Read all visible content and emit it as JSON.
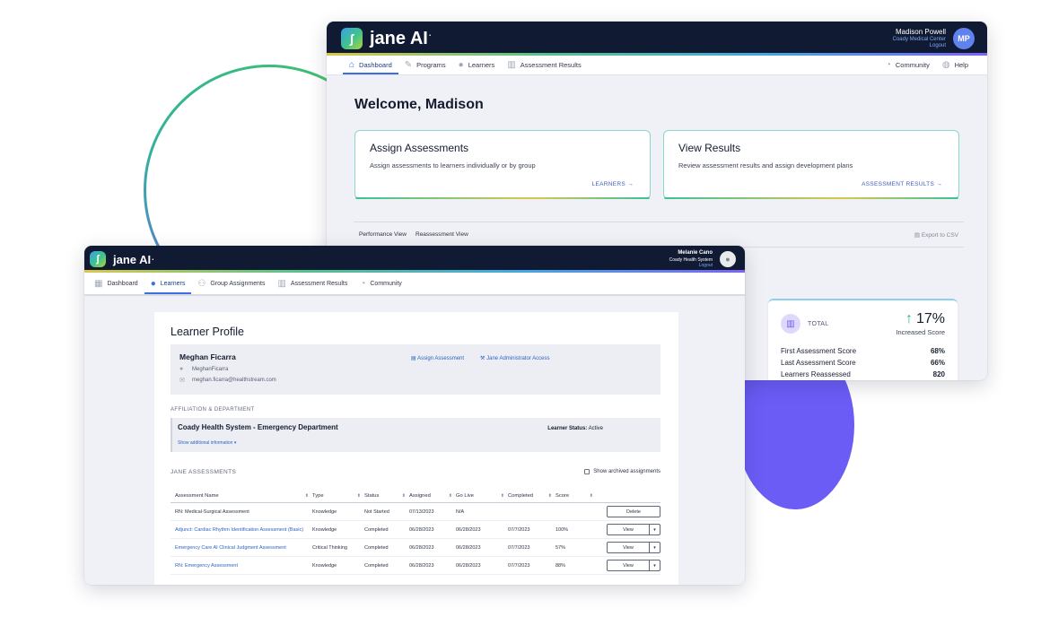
{
  "back": {
    "logo": {
      "mark": "ʃ",
      "text": "jane AI",
      "sup": "."
    },
    "user": {
      "name": "Madison Powell",
      "org": "Coady Medical Center",
      "logout": "Logout",
      "initials": "MP"
    },
    "nav": [
      {
        "label": "Dashboard",
        "icon": "home-icon",
        "glyph": "⌂"
      },
      {
        "label": "Programs",
        "icon": "pencil-icon",
        "glyph": "✎"
      },
      {
        "label": "Learners",
        "icon": "user-icon",
        "glyph": "●"
      },
      {
        "label": "Assessment Results",
        "icon": "bar-chart-icon",
        "glyph": "▥"
      }
    ],
    "nav_right": [
      {
        "label": "Community",
        "icon": "chat-icon",
        "glyph": "◔"
      },
      {
        "label": "Help",
        "icon": "help-icon",
        "glyph": "◍"
      }
    ],
    "welcome": "Welcome, Madison",
    "cards": [
      {
        "title": "Assign Assessments",
        "desc": "Assign assessments to learners individually or by group",
        "link": "LEARNERS"
      },
      {
        "title": "View Results",
        "desc": "Review assessment results and assign development plans",
        "link": "ASSESSMENT RESULTS"
      }
    ],
    "views": [
      "Performance View",
      "Reassessment View"
    ],
    "export": "Export to CSV",
    "stat": {
      "label": "TOTAL",
      "value": "17%",
      "sub": "Increased Score",
      "rows": [
        {
          "label": "First Assessment Score",
          "value": "68%"
        },
        {
          "label": "Last Assessment Score",
          "value": "66%"
        },
        {
          "label": "Learners Reassessed",
          "value": "820"
        }
      ]
    }
  },
  "front": {
    "logo": {
      "mark": "ʃ",
      "text": "jane AI",
      "sup": "."
    },
    "user": {
      "name": "Melanie Cano",
      "org": "Coady Health System",
      "logout": "Logout"
    },
    "nav": [
      {
        "label": "Dashboard",
        "icon": "dashboard-icon",
        "glyph": "▦"
      },
      {
        "label": "Learners",
        "icon": "user-icon",
        "glyph": "●"
      },
      {
        "label": "Group Assignments",
        "icon": "group-icon",
        "glyph": "⚇"
      },
      {
        "label": "Assessment Results",
        "icon": "bar-chart-icon",
        "glyph": "▥"
      },
      {
        "label": "Community",
        "icon": "chat-icon",
        "glyph": "◔"
      }
    ],
    "page_title": "Learner Profile",
    "learner": {
      "name": "Meghan Ficarra",
      "username": "MeghanFicarra",
      "email": "meghan.ficarra@healthstream.com",
      "assign_link": "Assign Assessment",
      "admin_link": "Jane Administrator Access"
    },
    "affiliation_label": "AFFILIATION & DEPARTMENT",
    "affiliation": {
      "name": "Coady Health System - Emergency Department",
      "more": "Show additional information",
      "status_label": "Learner Status:",
      "status": "Active"
    },
    "assessments_label": "JANE ASSESSMENTS",
    "archived_label": "Show archived assignments",
    "table": {
      "headers": [
        "Assessment Name",
        "Type",
        "Status",
        "Assigned",
        "Go Live",
        "Completed",
        "Score"
      ],
      "rows": [
        {
          "name": "RN: Medical-Surgical Assessment",
          "type": "Knowledge",
          "status": "Not Started",
          "assigned": "07/13/2023",
          "golive": "N/A",
          "completed": "",
          "score": "",
          "action": "Delete",
          "link": false
        },
        {
          "name": "Adjunct: Cardiac Rhythm Identification Assessment (Basic)",
          "type": "Knowledge",
          "status": "Completed",
          "assigned": "06/28/2023",
          "golive": "06/28/2023",
          "completed": "07/7/2023",
          "score": "100%",
          "action": "View",
          "link": true
        },
        {
          "name": "Emergency Care AI Clinical Judgment Assessment",
          "type": "Critical Thinking",
          "status": "Completed",
          "assigned": "06/28/2023",
          "golive": "06/28/2023",
          "completed": "07/7/2023",
          "score": "57%",
          "action": "View",
          "link": true
        },
        {
          "name": "RN: Emergency Assessment",
          "type": "Knowledge",
          "status": "Completed",
          "assigned": "06/28/2023",
          "golive": "06/28/2023",
          "completed": "07/7/2023",
          "score": "88%",
          "action": "View",
          "link": true
        }
      ]
    }
  }
}
